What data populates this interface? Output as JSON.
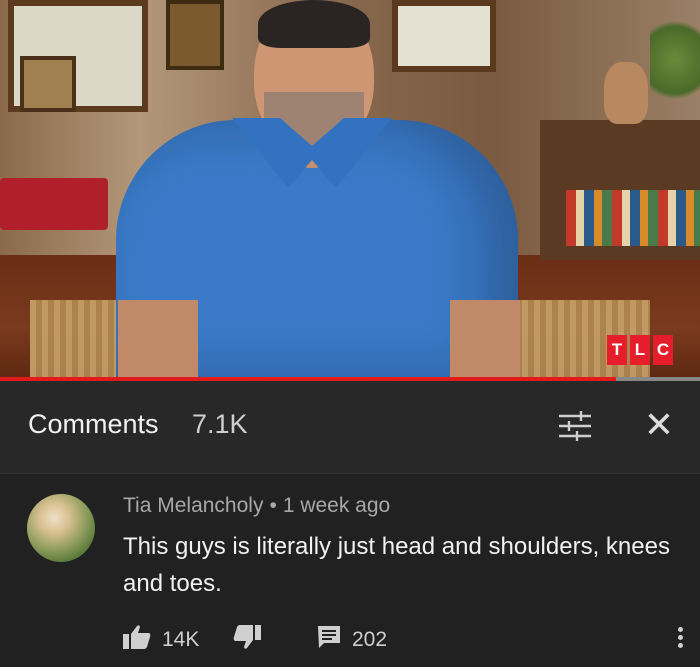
{
  "video": {
    "channel_logo_letters": [
      "T",
      "L",
      "C"
    ],
    "progress_fraction": 0.88,
    "progress_color": "#e31a1a"
  },
  "comments_header": {
    "title": "Comments",
    "count": "7.1K",
    "filter_icon": "sliders-icon",
    "close_icon": "close-icon",
    "close_glyph": "✕"
  },
  "comment": {
    "author": "Tia Melancholy",
    "separator": "•",
    "time": "1 week ago",
    "text": "This guys is literally just head and shoulders, knees and toes.",
    "likes": "14K",
    "replies": "202",
    "like_icon": "thumbs-up-icon",
    "dislike_icon": "thumbs-down-icon",
    "reply_icon": "reply-comment-icon",
    "more_icon": "more-vertical-icon"
  }
}
